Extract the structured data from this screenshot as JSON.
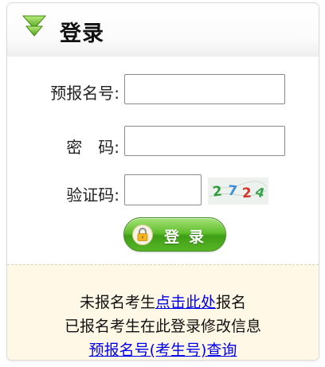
{
  "header": {
    "title": "登录",
    "icon": "green-down-arrow-icon"
  },
  "form": {
    "exam_number": {
      "label": "预报名号:",
      "value": ""
    },
    "password": {
      "label": "密　码:",
      "value": ""
    },
    "captcha": {
      "label": "验证码:",
      "value": "",
      "image_text": "2724"
    },
    "login_button": {
      "label": "登录",
      "icon": "lock-icon"
    }
  },
  "footer": {
    "line1_prefix": "未报名考生",
    "line1_link": "点击此处",
    "line1_suffix": "报名",
    "line2": "已报名考生在此登录修改信息",
    "line3_link": "预报名号(考生号)查询"
  },
  "colors": {
    "button_green": "#4cae1e",
    "arrow_green": "#66b822",
    "link_blue": "#0000ee",
    "footer_background": "#fff8e6"
  }
}
